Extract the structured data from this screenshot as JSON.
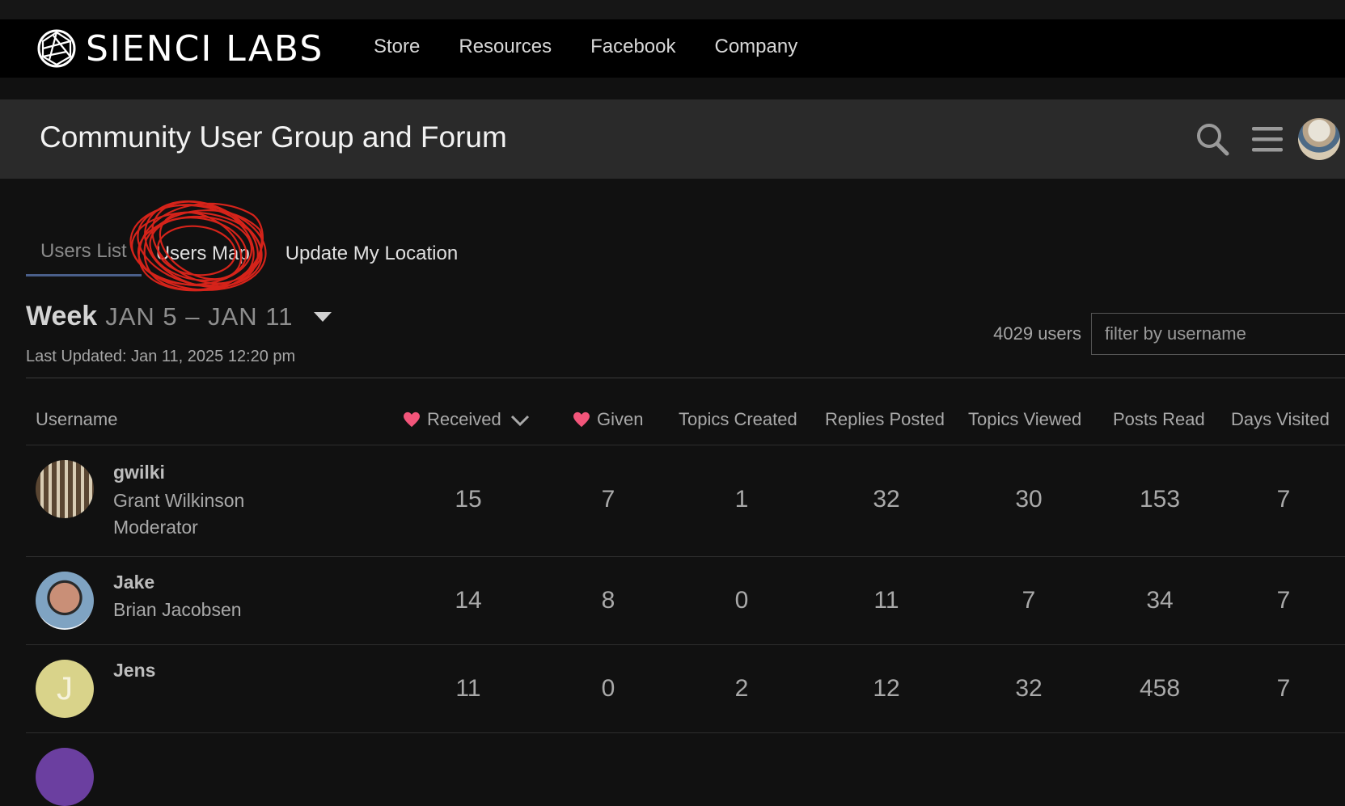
{
  "brand": {
    "name": "SIENCI LABS",
    "nav": [
      "Store",
      "Resources",
      "Facebook",
      "Company"
    ]
  },
  "forum": {
    "title": "Community User Group and Forum",
    "icons": [
      "search-icon",
      "hamburger-menu-icon",
      "user-avatar"
    ]
  },
  "tabs": [
    {
      "label": "Users List",
      "active": true
    },
    {
      "label": "Users Map",
      "active": false
    },
    {
      "label": "Update My Location",
      "active": false
    }
  ],
  "period": {
    "label": "Week",
    "range": "JAN 5 – JAN 11",
    "last_updated": "Last Updated: Jan 11, 2025 12:20 pm"
  },
  "directory": {
    "user_count": "4029 users",
    "filter_placeholder": "filter by username"
  },
  "table": {
    "columns": [
      "Username",
      "Received",
      "Given",
      "Topics Created",
      "Replies Posted",
      "Topics Viewed",
      "Posts Read",
      "Days Visited"
    ],
    "rows": [
      {
        "username": "gwilki",
        "name": "Grant Wilkinson",
        "title": "Moderator",
        "values": [
          "15",
          "7",
          "1",
          "32",
          "30",
          "153",
          "7"
        ]
      },
      {
        "username": "Jake",
        "name": "Brian Jacobsen",
        "title": "",
        "values": [
          "14",
          "8",
          "0",
          "11",
          "7",
          "34",
          "7"
        ]
      },
      {
        "username": "Jens",
        "name": "",
        "title": "",
        "avatar_letter": "J",
        "values": [
          "11",
          "0",
          "2",
          "12",
          "32",
          "458",
          "7"
        ]
      }
    ]
  },
  "colors": {
    "heart": "#f2557a",
    "annotation": "#e0251b",
    "avatar_letter_bg": "#d9d38a",
    "active_tab_underline": "#4a5f8a"
  }
}
